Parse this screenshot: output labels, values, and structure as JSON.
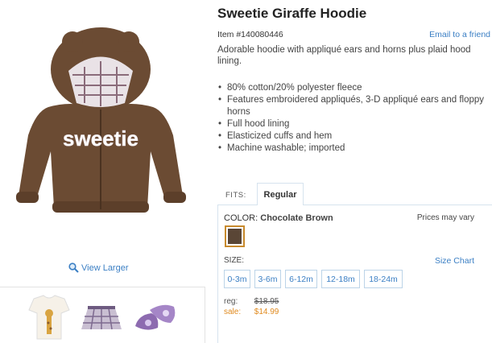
{
  "product": {
    "title": "Sweetie Giraffe Hoodie",
    "item_number": "Item #140080446",
    "email_link": "Email to a friend",
    "description": "Adorable hoodie with appliqué ears and horns plus plaid hood lining.",
    "features": [
      "80% cotton/20% polyester fleece",
      "Features embroidered appliqués, 3-D appliqué ears and floppy horns",
      "Full hood lining",
      "Elasticized cuffs and hem",
      "Machine washable; imported"
    ],
    "hero_text": "sweetie"
  },
  "gallery": {
    "view_larger": "View Larger",
    "thumbnails": [
      "giraffe-bodysuit",
      "plaid-skirt",
      "purple-shoes"
    ]
  },
  "fits": {
    "label": "FITS:",
    "selected": "Regular"
  },
  "color": {
    "label": "COLOR:",
    "value": "Chocolate Brown",
    "swatch": "#5a4636",
    "prices_note": "Prices may vary"
  },
  "size": {
    "label": "SIZE:",
    "chart_link": "Size Chart",
    "options": [
      "0-3m",
      "3-6m",
      "6-12m",
      "12-18m",
      "18-24m"
    ]
  },
  "pricing": {
    "reg_label": "reg:",
    "reg_value": "$18.95",
    "sale_label": "sale:",
    "sale_value": "$14.99"
  },
  "colors": {
    "link": "#3b7fc4",
    "sale": "#e08a1e",
    "hoodie": "#6b4b33"
  }
}
